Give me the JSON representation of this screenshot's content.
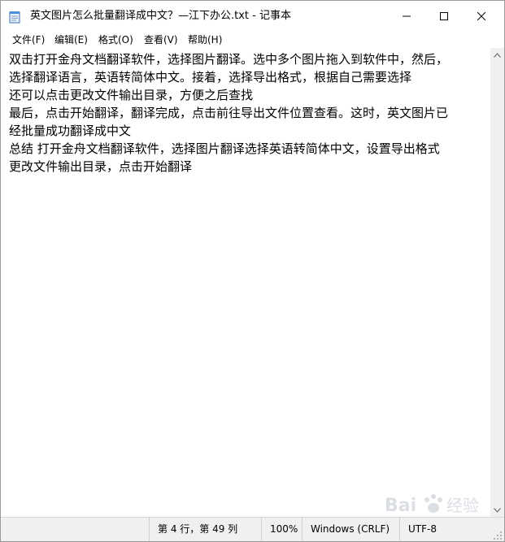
{
  "window": {
    "title": "英文图片怎么批量翻译成中文？—江下办公.txt - 记事本",
    "app_icon": "notepad-icon"
  },
  "menu": {
    "items": [
      {
        "label": "文件(F)"
      },
      {
        "label": "编辑(E)"
      },
      {
        "label": "格式(O)"
      },
      {
        "label": "查看(V)"
      },
      {
        "label": "帮助(H)"
      }
    ]
  },
  "editor": {
    "lines": [
      "双击打开金舟文档翻译软件，选择图片翻译。选中多个图片拖入到软件中，然后，",
      "选择翻译语言，英语转简体中文。接着，选择导出格式，根据自己需要选择",
      "还可以点击更改文件输出目录，方便之后查找",
      "最后，点击开始翻译，翻译完成，点击前往导出文件位置查看。这时，英文图片已",
      "经批量成功翻译成中文",
      "总结 打开金舟文档翻译软件，选择图片翻译选择英语转简体中文，设置导出格式",
      "更改文件输出目录，点击开始翻译"
    ]
  },
  "status": {
    "position": "第 4 行，第 49 列",
    "zoom": "100%",
    "line_ending": "Windows (CRLF)",
    "encoding": "UTF-8"
  },
  "watermark": {
    "text": "Bai经验"
  }
}
